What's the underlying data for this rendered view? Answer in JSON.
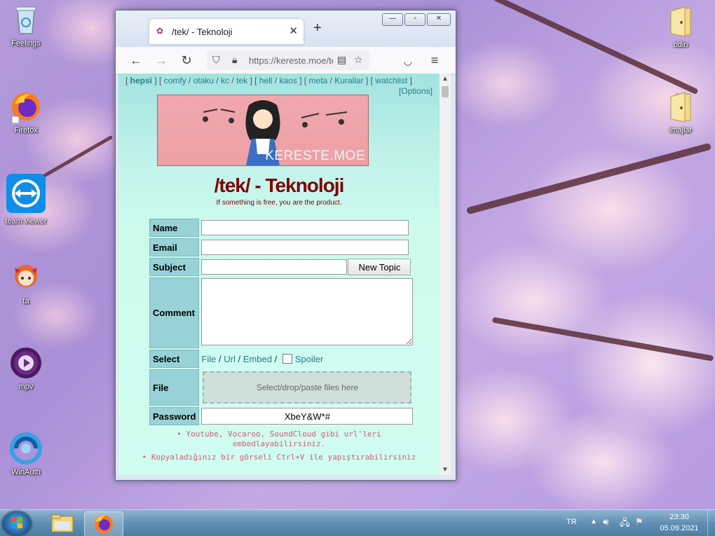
{
  "desktop": {
    "icons_left": [
      {
        "label": "Feelings"
      },
      {
        "label": "Firefox"
      },
      {
        "label": "team viewer"
      },
      {
        "label": "ta"
      },
      {
        "label": "mpv"
      },
      {
        "label": "WinAuth"
      }
    ],
    "icons_right": [
      {
        "label": "odin"
      },
      {
        "label": "imajlar"
      }
    ]
  },
  "browser": {
    "tab_title": "/tek/ - Teknoloji",
    "tab_close": "✕",
    "new_tab": "+",
    "url": "https://kereste.moe/tek",
    "controls": {
      "minimize": "—",
      "maximize": "▫",
      "close": "✕"
    }
  },
  "page": {
    "boardlist": {
      "parts": [
        {
          "type": "text",
          "value": "[ "
        },
        {
          "type": "bold",
          "value": "hepsi"
        },
        {
          "type": "text",
          "value": " ] [ "
        },
        {
          "type": "link",
          "value": "comfy"
        },
        {
          "type": "text",
          "value": " / "
        },
        {
          "type": "link",
          "value": "otaku"
        },
        {
          "type": "text",
          "value": " / "
        },
        {
          "type": "link",
          "value": "kc"
        },
        {
          "type": "text",
          "value": " / "
        },
        {
          "type": "link",
          "value": "tek"
        },
        {
          "type": "text",
          "value": " ] [ "
        },
        {
          "type": "link",
          "value": "hell"
        },
        {
          "type": "text",
          "value": " / "
        },
        {
          "type": "link",
          "value": "kaos"
        },
        {
          "type": "text",
          "value": " ] [ "
        },
        {
          "type": "link",
          "value": "meta"
        },
        {
          "type": "text",
          "value": " / "
        },
        {
          "type": "link",
          "value": "Kurallar"
        },
        {
          "type": "text",
          "value": " ] [ "
        },
        {
          "type": "link",
          "value": "watchlist"
        },
        {
          "type": "text",
          "value": " ]"
        }
      ]
    },
    "options_link": "[Options]",
    "banner_text": "KERESTE.MOE",
    "title": "/tek/ - Teknoloji",
    "subtitle": "If something is free, you are the product.",
    "form": {
      "name_label": "Name",
      "email_label": "Email",
      "subject_label": "Subject",
      "new_topic_button": "New Topic",
      "comment_label": "Comment",
      "select_label": "Select",
      "select_file": "File",
      "select_url": "Url",
      "select_embed": "Embed",
      "select_sep": "/",
      "spoiler_label": "Spoiler",
      "file_label": "File",
      "dropzone_text": "Select/drop/paste files here",
      "password_label": "Password",
      "password_value": "XbeY&W*#"
    },
    "notes": [
      "• Youtube, Vocaroo, SoundCloud gibi url'leri",
      "embedlayabilirsiniz.",
      "• Kopyaladığınız bir görseli Ctrl+V ile yapıştırabilirsiniz"
    ]
  },
  "taskbar": {
    "language": "TR",
    "time": "23:30",
    "date": "05.09.2021"
  },
  "colors": {
    "board_title": "#800000",
    "link": "#2c7b8a",
    "label_bg": "#98d2d6",
    "notes": "#d45a78"
  }
}
